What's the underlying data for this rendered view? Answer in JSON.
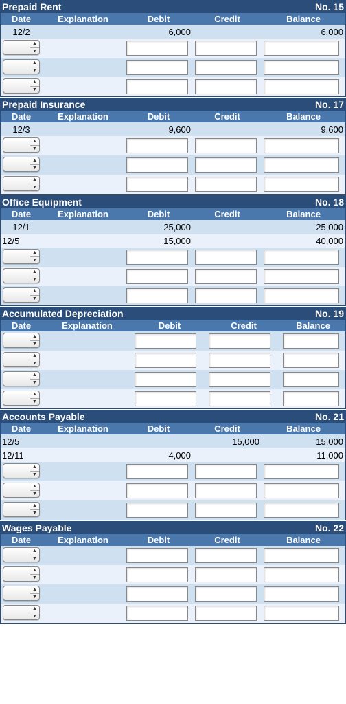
{
  "columns": {
    "date": "Date",
    "explanation": "Explanation",
    "debit": "Debit",
    "credit": "Credit",
    "balance": "Balance"
  },
  "no_prefix": "No. ",
  "ledgers": [
    {
      "id": "prepaid-rent",
      "title": "Prepaid Rent",
      "number": "15",
      "wide": false,
      "rows": [
        {
          "type": "data",
          "stripe": "a",
          "date": "12/2",
          "date_align": "center",
          "debit": "6,000",
          "credit": "",
          "balance": "6,000"
        },
        {
          "type": "input",
          "stripe": "b"
        },
        {
          "type": "input",
          "stripe": "a"
        },
        {
          "type": "input",
          "stripe": "b"
        }
      ]
    },
    {
      "id": "prepaid-insurance",
      "title": "Prepaid Insurance",
      "number": "17",
      "wide": false,
      "rows": [
        {
          "type": "data",
          "stripe": "a",
          "date": "12/3",
          "date_align": "center",
          "debit": "9,600",
          "credit": "",
          "balance": "9,600"
        },
        {
          "type": "input",
          "stripe": "b"
        },
        {
          "type": "input",
          "stripe": "a"
        },
        {
          "type": "input",
          "stripe": "b"
        }
      ]
    },
    {
      "id": "office-equipment",
      "title": "Office Equipment",
      "number": "18",
      "wide": false,
      "rows": [
        {
          "type": "data",
          "stripe": "a",
          "date": "12/1",
          "date_align": "center",
          "debit": "25,000",
          "credit": "",
          "balance": "25,000"
        },
        {
          "type": "data",
          "stripe": "b",
          "date": "12/5",
          "date_align": "left",
          "debit": "15,000",
          "credit": "",
          "balance": "40,000"
        },
        {
          "type": "input",
          "stripe": "a"
        },
        {
          "type": "input",
          "stripe": "b"
        },
        {
          "type": "input",
          "stripe": "a"
        }
      ]
    },
    {
      "id": "accum-depr",
      "title": "Accumulated Depreciation",
      "number": "19",
      "wide": true,
      "rows": [
        {
          "type": "input",
          "stripe": "a"
        },
        {
          "type": "input",
          "stripe": "b"
        },
        {
          "type": "input",
          "stripe": "a"
        },
        {
          "type": "input",
          "stripe": "b"
        }
      ]
    },
    {
      "id": "accounts-payable",
      "title": "Accounts Payable",
      "number": "21",
      "wide": false,
      "rows": [
        {
          "type": "data",
          "stripe": "a",
          "date": "12/5",
          "date_align": "left",
          "debit": "",
          "credit": "15,000",
          "balance": "15,000"
        },
        {
          "type": "data",
          "stripe": "b",
          "date": "12/11",
          "date_align": "left",
          "debit": "4,000",
          "credit": "",
          "balance": "11,000"
        },
        {
          "type": "input",
          "stripe": "a"
        },
        {
          "type": "input",
          "stripe": "b"
        },
        {
          "type": "input",
          "stripe": "a"
        }
      ]
    },
    {
      "id": "wages-payable",
      "title": "Wages Payable",
      "number": "22",
      "wide": false,
      "rows": [
        {
          "type": "input",
          "stripe": "a"
        },
        {
          "type": "input",
          "stripe": "b"
        },
        {
          "type": "input",
          "stripe": "a"
        },
        {
          "type": "input",
          "stripe": "b"
        }
      ]
    }
  ]
}
